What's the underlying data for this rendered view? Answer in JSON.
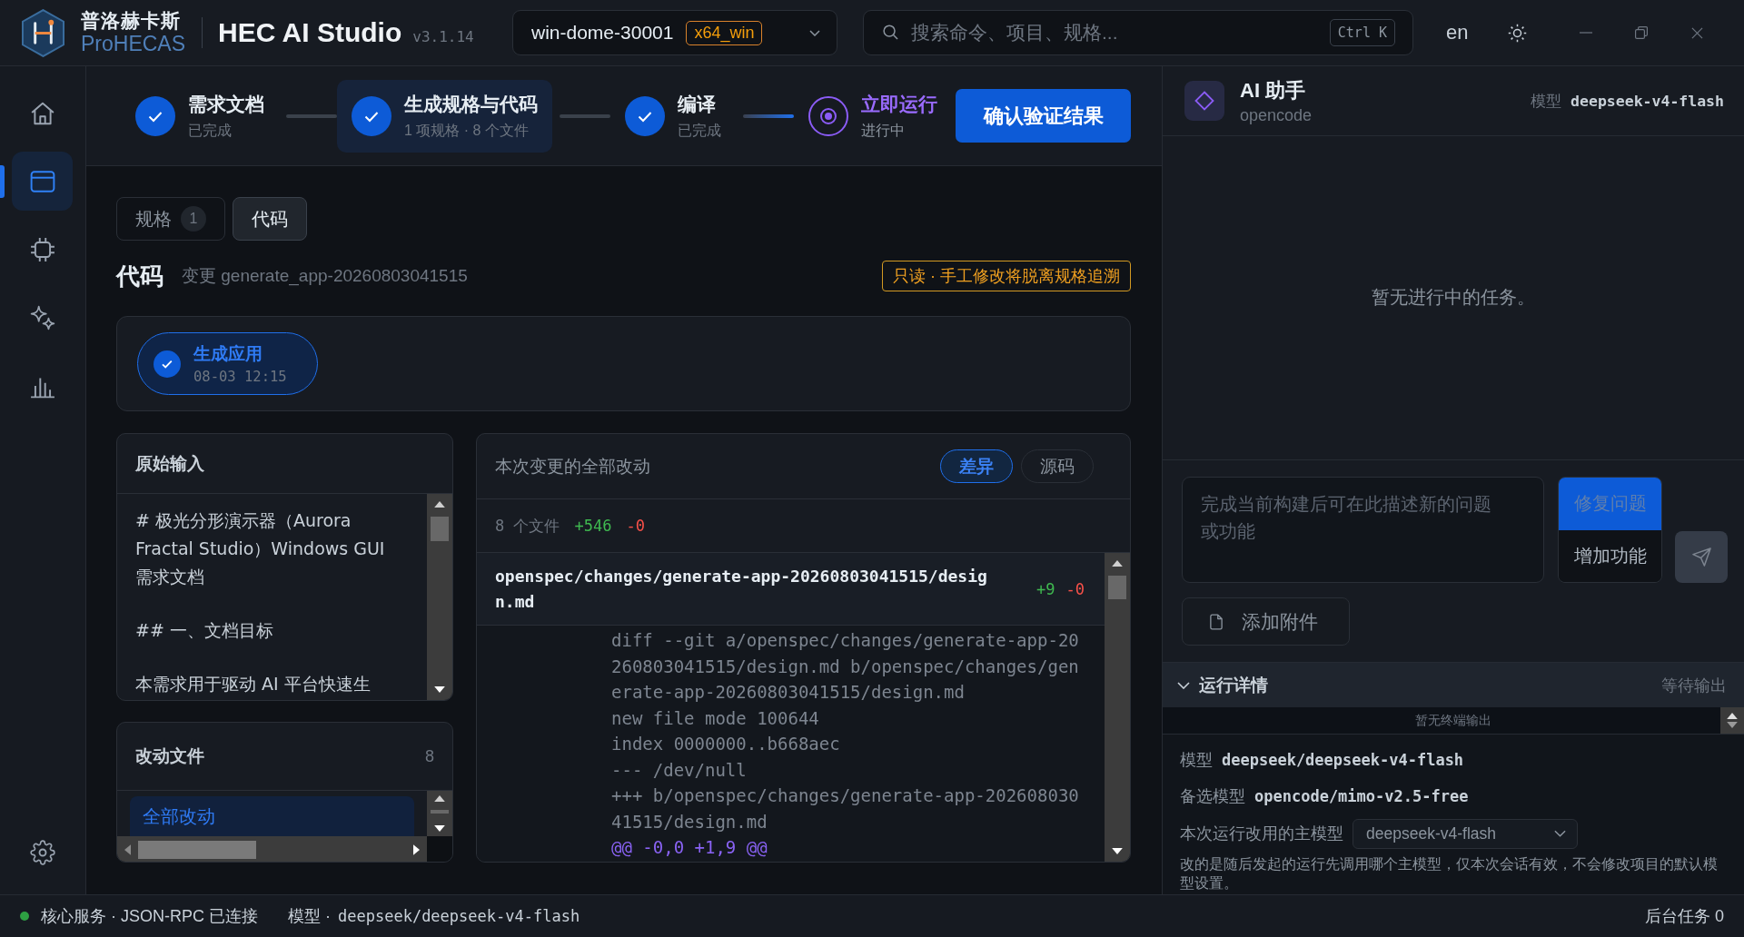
{
  "window": {
    "brand_name": "普洛赫卡斯",
    "brand_subtitle": "ProHECAS",
    "title": "HEC AI Studio",
    "version": "v3.1.14"
  },
  "project_selector": {
    "name": "win-dome-30001",
    "platform": "x64_win"
  },
  "search": {
    "placeholder": "搜索命令、项目、规格...",
    "shortcut": "Ctrl K"
  },
  "language": {
    "label": "en"
  },
  "sidebar": {
    "items": [
      {
        "kind": "home",
        "selected": false
      },
      {
        "kind": "window",
        "selected": true
      },
      {
        "kind": "chip",
        "selected": false
      },
      {
        "kind": "sparkle",
        "selected": false
      },
      {
        "kind": "chart",
        "selected": false
      }
    ]
  },
  "stepper": {
    "steps": [
      {
        "title": "需求文档",
        "subtitle": "已完成",
        "done": true,
        "selected": false
      },
      {
        "title": "生成规格与代码",
        "subtitle": "1 项规格 · 8 个文件",
        "done": true,
        "selected": true
      },
      {
        "title": "编译",
        "subtitle": "已完成",
        "done": true,
        "selected": false
      },
      {
        "title": "立即运行",
        "subtitle": "进行中",
        "done": false,
        "selected": false
      }
    ],
    "action": "确认验证结果"
  },
  "tabs": [
    {
      "label": "规格",
      "count": "1",
      "selected": false
    },
    {
      "label": "代码",
      "selected": true
    }
  ],
  "code_header": {
    "title": "代码",
    "change": "变更 generate_app-20260803041515",
    "notice": "只读 · 手工修改将脱离规格追溯"
  },
  "runs": [
    {
      "title": "生成应用",
      "time": "08-03 12:15",
      "done": true,
      "selected": true
    }
  ],
  "original_input": {
    "title": "原始输入",
    "paragraphs": [
      "# 极光分形演示器（Aurora Fractal Studio）Windows GUI 需求文档",
      "## 一、文档目标",
      "本需求用于驱动 AI 平台快速生"
    ]
  },
  "changed_files": {
    "title": "改动文件",
    "count": "8",
    "items": [
      {
        "label": "全部改动",
        "selected": true
      }
    ]
  },
  "diff": {
    "title": "本次变更的全部改动",
    "modes": [
      {
        "label": "差异",
        "selected": true
      },
      {
        "label": "源码",
        "selected": false
      }
    ],
    "summary": {
      "files": "8 个文件",
      "added": "+546",
      "removed": "-0"
    },
    "files": [
      {
        "path": "openspec/changes/generate-app-20260803041515/design.md",
        "added": "+9",
        "removed": "-0",
        "lines": [
          {
            "kind": "meta",
            "text": "diff --git a/openspec/changes/generate-app-20260803041515/design.md b/openspec/changes/generate-app-20260803041515/design.md"
          },
          {
            "kind": "meta",
            "text": "new file mode 100644"
          },
          {
            "kind": "meta",
            "text": "index 0000000..b668aec"
          },
          {
            "kind": "meta",
            "text": "--- /dev/null"
          },
          {
            "kind": "meta",
            "text": "+++ b/openspec/changes/generate-app-20260803041515/design.md"
          },
          {
            "kind": "hunk",
            "text": "@@ -0,0 +1,9 @@"
          }
        ]
      }
    ]
  },
  "assistant": {
    "title": "AI 助手",
    "agent": "opencode",
    "model_label": "模型",
    "model": "deepseek-v4-flash",
    "empty_text": "暂无进行中的任务。",
    "composer": {
      "placeholder": "完成当前构建后可在此描述新的问题或功能",
      "modes": [
        {
          "label": "修复问题",
          "selected": true
        },
        {
          "label": "增加功能",
          "selected": false
        }
      ],
      "send_disabled": true,
      "attach_label": "添加附件"
    },
    "details": {
      "title": "运行详情",
      "expanded": true,
      "status": "等待输出",
      "terminal_text": "暂无终端输出",
      "fields": [
        {
          "label": "模型",
          "value": "deepseek/deepseek-v4-flash"
        },
        {
          "label": "备选模型",
          "value": "opencode/mimo-v2.5-free"
        }
      ],
      "override_label": "本次运行改用的主模型",
      "override_value": "deepseek-v4-flash",
      "note": "改的是随后发起的运行先调用哪个主模型，仅本次会话有效，不会修改项目的默认模型设置。"
    }
  },
  "status_bar": {
    "connected": true,
    "service": "核心服务 · JSON-RPC 已连接",
    "model_label": "模型 ·",
    "model": "deepseek/deepseek-v4-flash",
    "tasks": "后台任务 0"
  }
}
